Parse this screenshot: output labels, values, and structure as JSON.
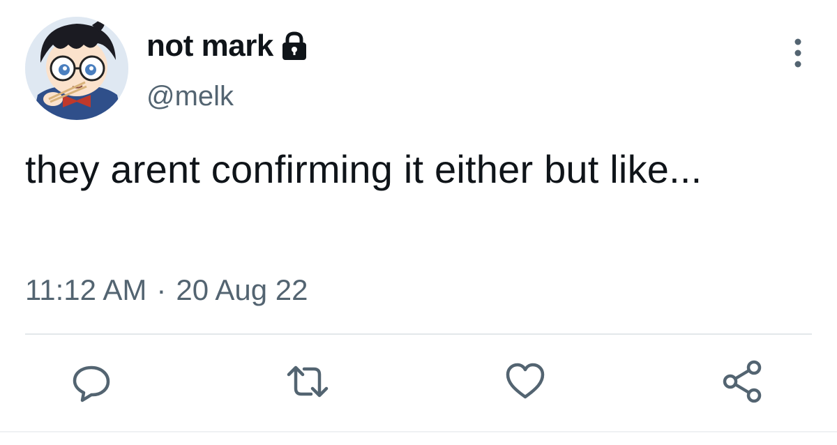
{
  "user": {
    "display_name": "not mark",
    "handle": "@melk",
    "protected": true,
    "avatar_icon": "anime-avatar"
  },
  "tweet": {
    "text": "they arent confirming it either but like...",
    "time": "11:12 AM",
    "separator": "·",
    "date": "20 Aug 22"
  },
  "actions": {
    "reply_icon": "reply-icon",
    "retweet_icon": "retweet-icon",
    "like_icon": "like-icon",
    "share_icon": "share-icon"
  },
  "colors": {
    "text_primary": "#0f1419",
    "text_secondary": "#536471",
    "icon_gray": "#536471",
    "divider": "#e3e7ea"
  }
}
